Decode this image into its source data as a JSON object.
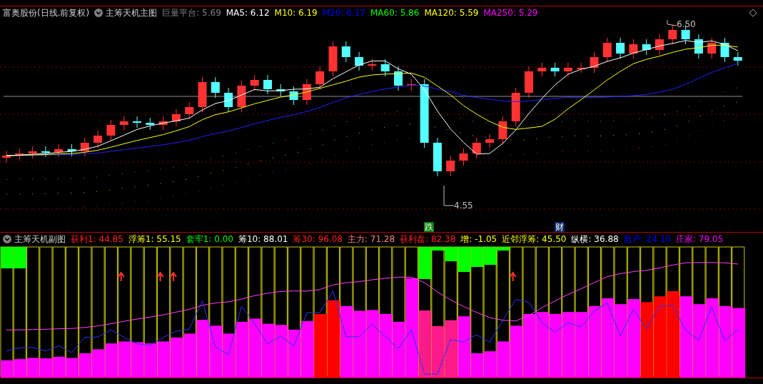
{
  "main_chart": {
    "title": "富奥股份(日线.前复权)",
    "indicator": "主筹天机主图",
    "values": [
      {
        "text": "巨量平台: 5.69",
        "color": "#808080"
      },
      {
        "text": "MA5: 6.12",
        "color": "#ffffff"
      },
      {
        "text": "M10: 6.19",
        "color": "#ffff00"
      },
      {
        "text": "M20: 6.17",
        "color": "#0000ff"
      },
      {
        "text": "MA60: 5.86",
        "color": "#00ff00"
      },
      {
        "text": "MA120: 5.59",
        "color": "#ffff00"
      },
      {
        "text": "MA250: 5.29",
        "color": "#ff00ff"
      }
    ],
    "high_label": "6.50",
    "low_label": "4.55",
    "signals": [
      {
        "text": "跌",
        "color": "#008000"
      },
      {
        "text": "财",
        "color": "#0a2a6a"
      }
    ]
  },
  "sub_chart": {
    "indicator": "主筹天机副图",
    "values": [
      {
        "text": "获利1: 44.85",
        "color": "#ff2020"
      },
      {
        "text": "浮筹1: 55.15",
        "color": "#ffff00"
      },
      {
        "text": "套牢1: 0.00",
        "color": "#00ff00"
      },
      {
        "text": "筹10: 88.01",
        "color": "#ffffff"
      },
      {
        "text": "筹30: 96.08",
        "color": "#ff2020"
      },
      {
        "text": "主力: 71.28",
        "color": "#ff8080"
      },
      {
        "text": "获利盘: 82.38",
        "color": "#ff2020"
      },
      {
        "text": "增: -1.05",
        "color": "#ffff00"
      },
      {
        "text": "近邻浮筹: 45.50",
        "color": "#ffff00"
      },
      {
        "text": "纵横: 36.88",
        "color": "#ffffff"
      },
      {
        "text": "散户: 24.10",
        "color": "#0000ff"
      },
      {
        "text": "庄家: 79.05",
        "color": "#ff00ff"
      }
    ]
  }
}
